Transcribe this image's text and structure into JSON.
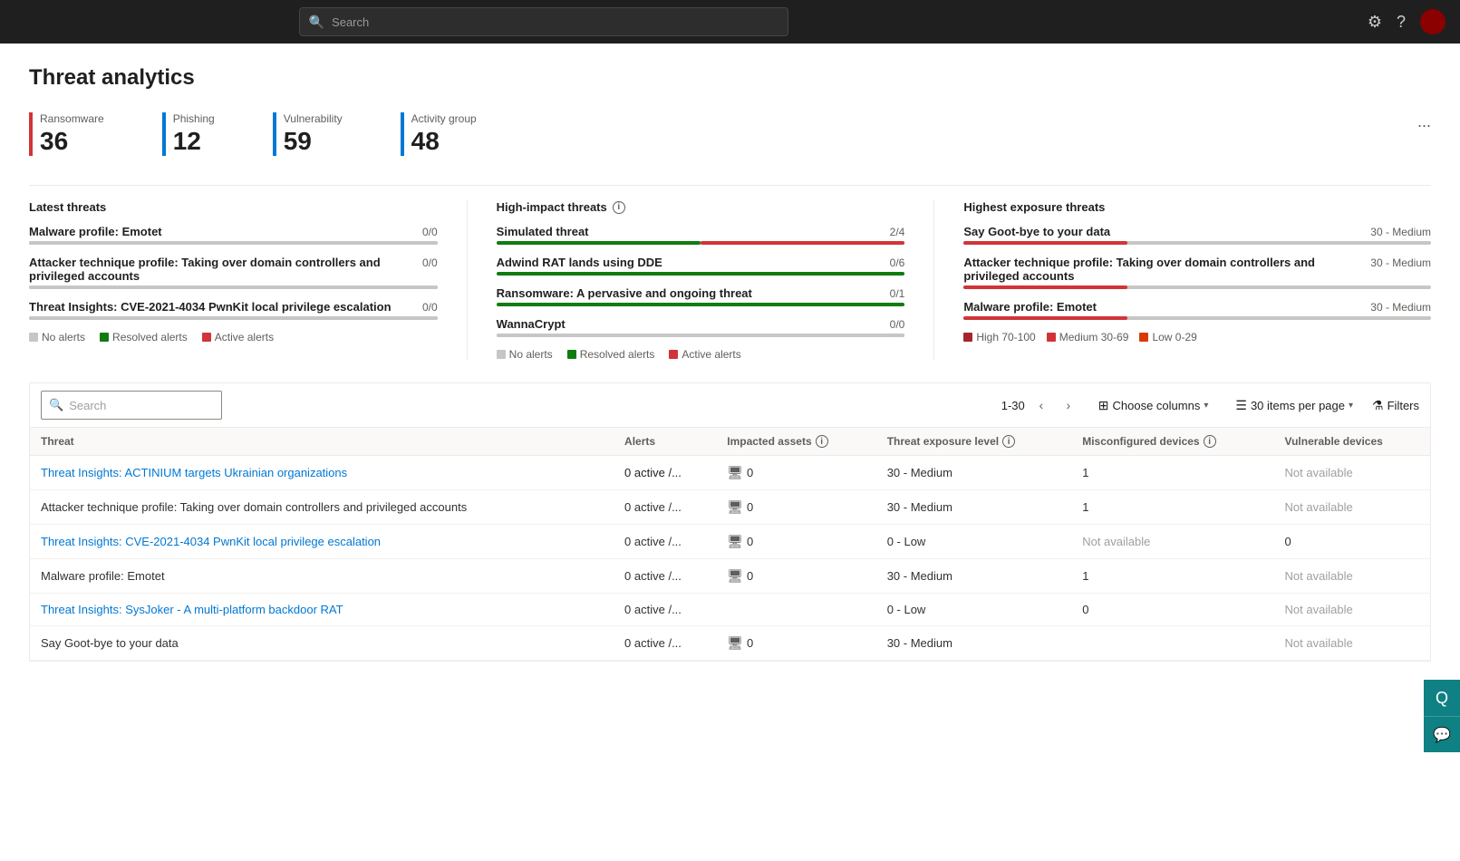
{
  "topbar": {
    "search_placeholder": "Search",
    "settings_icon": "⚙",
    "help_icon": "?"
  },
  "page": {
    "title": "Threat analytics"
  },
  "stats": [
    {
      "label": "Ransomware",
      "value": "36",
      "color": "red"
    },
    {
      "label": "Phishing",
      "value": "12",
      "color": "blue"
    },
    {
      "label": "Vulnerability",
      "value": "59",
      "color": "blue2"
    },
    {
      "label": "Activity group",
      "value": "48",
      "color": "blue3"
    }
  ],
  "more_label": "...",
  "sections": {
    "latest_threats": {
      "title": "Latest threats",
      "items": [
        {
          "name": "Malware profile: Emotet",
          "score": "0/0",
          "red_pct": 0,
          "green_pct": 0
        },
        {
          "name": "Attacker technique profile: Taking over domain controllers and privileged accounts",
          "score": "0/0",
          "red_pct": 0,
          "green_pct": 0
        },
        {
          "name": "Threat Insights: CVE-2021-4034 PwnKit local privilege escalation",
          "score": "0/0",
          "red_pct": 0,
          "green_pct": 0
        }
      ],
      "legend": [
        {
          "color": "gray",
          "label": "No alerts"
        },
        {
          "color": "green",
          "label": "Resolved alerts"
        },
        {
          "color": "red",
          "label": "Active alerts"
        }
      ]
    },
    "high_impact": {
      "title": "High-impact threats",
      "items": [
        {
          "name": "Simulated threat",
          "score": "2/4",
          "red_pct": 50,
          "green_pct": 50
        },
        {
          "name": "Adwind RAT lands using DDE",
          "score": "0/6",
          "red_pct": 0,
          "green_pct": 100
        },
        {
          "name": "Ransomware: A pervasive and ongoing threat",
          "score": "0/1",
          "red_pct": 0,
          "green_pct": 100
        },
        {
          "name": "WannaCrypt",
          "score": "0/0",
          "red_pct": 0,
          "green_pct": 0
        }
      ],
      "legend": [
        {
          "color": "gray",
          "label": "No alerts"
        },
        {
          "color": "green",
          "label": "Resolved alerts"
        },
        {
          "color": "red",
          "label": "Active alerts"
        }
      ]
    },
    "highest_exposure": {
      "title": "Highest exposure threats",
      "items": [
        {
          "name": "Say Goot-bye to your data",
          "score": "30 - Medium",
          "red_pct": 35,
          "green_pct": 0
        },
        {
          "name": "Attacker technique profile: Taking over domain controllers and privileged accounts",
          "score": "30 - Medium",
          "red_pct": 35,
          "green_pct": 0
        },
        {
          "name": "Malware profile: Emotet",
          "score": "30 - Medium",
          "red_pct": 35,
          "green_pct": 0
        }
      ],
      "legend": [
        {
          "color": "darkred",
          "label": "High 70-100"
        },
        {
          "color": "red",
          "label": "Medium 30-69"
        },
        {
          "color": "orange",
          "label": "Low 0-29"
        }
      ]
    }
  },
  "table": {
    "search_placeholder": "Search",
    "search_label": "Search",
    "pagination": "1-30",
    "choose_columns_label": "Choose columns",
    "items_per_page_label": "30 items per page",
    "filters_label": "Filters",
    "columns": [
      "Threat",
      "Alerts",
      "Impacted assets",
      "Threat exposure level",
      "Misconfigured devices",
      "Vulnerable devices"
    ],
    "rows": [
      {
        "threat": "Threat Insights: ACTINIUM targets Ukrainian organizations",
        "threat_link": true,
        "alerts": "0 active /...",
        "impacted": "0",
        "exposure": "30 - Medium",
        "misconfigured": "1",
        "vulnerable": "Not available"
      },
      {
        "threat": "Attacker technique profile: Taking over domain controllers and privileged accounts",
        "threat_link": false,
        "alerts": "0 active /...",
        "impacted": "0",
        "exposure": "30 - Medium",
        "misconfigured": "1",
        "vulnerable": "Not available"
      },
      {
        "threat": "Threat Insights: CVE-2021-4034 PwnKit local privilege escalation",
        "threat_link": true,
        "alerts": "0 active /...",
        "impacted": "0",
        "exposure": "0 - Low",
        "misconfigured": "Not available",
        "vulnerable": "0"
      },
      {
        "threat": "Malware profile: Emotet",
        "threat_link": false,
        "alerts": "0 active /...",
        "impacted": "0",
        "exposure": "30 - Medium",
        "misconfigured": "1",
        "vulnerable": "Not available"
      },
      {
        "threat": "Threat Insights: SysJoker - A multi-platform backdoor RAT",
        "threat_link": true,
        "alerts": "0 active /...",
        "impacted": "",
        "exposure": "0 - Low",
        "misconfigured": "0",
        "vulnerable": "Not available"
      },
      {
        "threat": "Say Goot-bye to your data",
        "threat_link": false,
        "alerts": "0 active /...",
        "impacted": "0",
        "exposure": "30 - Medium",
        "misconfigured": "",
        "vulnerable": "Not available"
      }
    ]
  },
  "floating_buttons": {
    "chat_icon": "Q",
    "message_icon": "💬"
  }
}
